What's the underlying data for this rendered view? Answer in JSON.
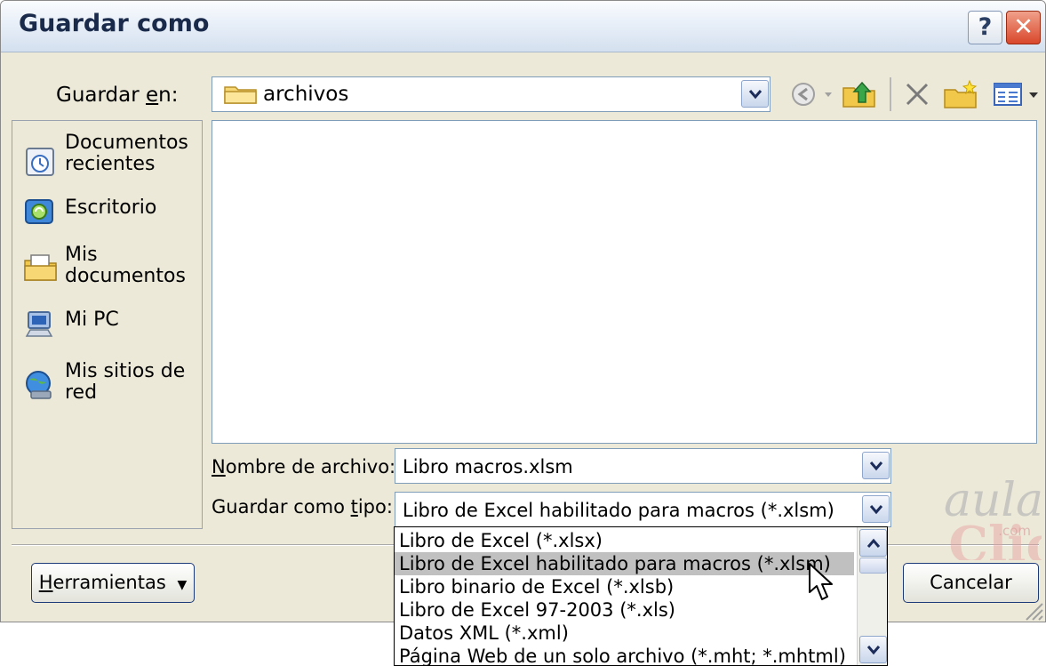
{
  "window": {
    "title": "Guardar como",
    "help_label": "?",
    "close_label": "✕"
  },
  "save_in": {
    "label": "Guardar en:",
    "value": "archivos"
  },
  "toolbar": {
    "icons": [
      "back-icon",
      "up-folder-icon",
      "delete-icon",
      "new-folder-icon",
      "views-icon"
    ]
  },
  "places": [
    {
      "label": "Documentos recientes",
      "icon": "recent-documents-icon"
    },
    {
      "label": "Escritorio",
      "icon": "desktop-icon"
    },
    {
      "label": "Mis documentos",
      "icon": "my-documents-icon"
    },
    {
      "label": "Mi PC",
      "icon": "my-computer-icon"
    },
    {
      "label": "Mis sitios de red",
      "icon": "network-places-icon"
    }
  ],
  "filename": {
    "label": "Nombre de archivo:",
    "value": "Libro macros.xlsm"
  },
  "filetype": {
    "label": "Guardar como tipo:",
    "value": "Libro de Excel habilitado para macros (*.xlsm)",
    "options": [
      "Libro de Excel (*.xlsx)",
      "Libro de Excel habilitado para macros (*.xlsm)",
      "Libro binario de Excel (*.xlsb)",
      "Libro de Excel 97-2003 (*.xls)",
      "Datos XML (*.xml)",
      "Página Web de un solo archivo (*.mht; *.mhtml)"
    ],
    "selected_index": 1
  },
  "buttons": {
    "tools": "Herramientas",
    "cancel": "Cancelar"
  },
  "watermark": {
    "line1": "aula",
    "line2": "Clic",
    "line3": ".com"
  }
}
